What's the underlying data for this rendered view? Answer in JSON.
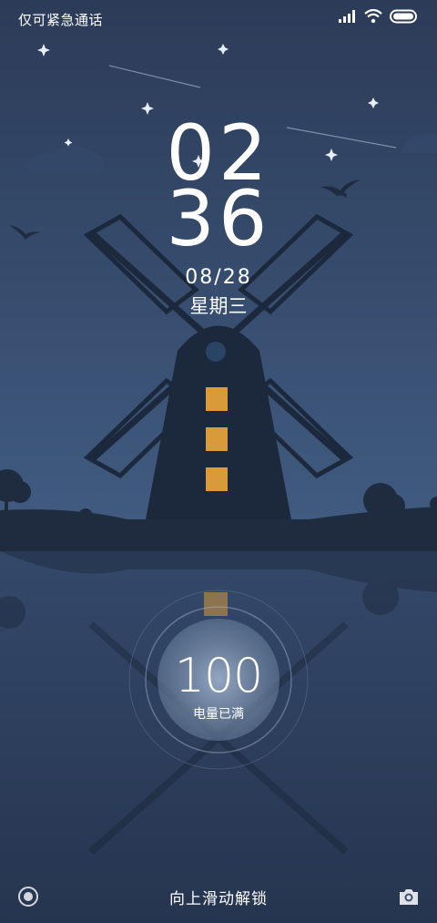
{
  "status_bar": {
    "carrier_text": "仅可紧急通话",
    "icons": [
      "signal-icon",
      "wifi-icon",
      "battery-icon"
    ]
  },
  "lock_screen": {
    "hour": "02",
    "minute": "36",
    "date": "08/28",
    "weekday": "星期三",
    "battery_percent": "100",
    "battery_status": "电量已满",
    "unlock_hint": "向上滑动解锁"
  },
  "shortcuts": {
    "left_icon": "record-icon",
    "right_icon": "camera-icon"
  },
  "colors": {
    "sky_top": "#2c3b58",
    "sky_bottom": "#3a5478",
    "ground": "#1f2c40",
    "window_light": "#d99a3a",
    "water": "#2a3b57"
  }
}
